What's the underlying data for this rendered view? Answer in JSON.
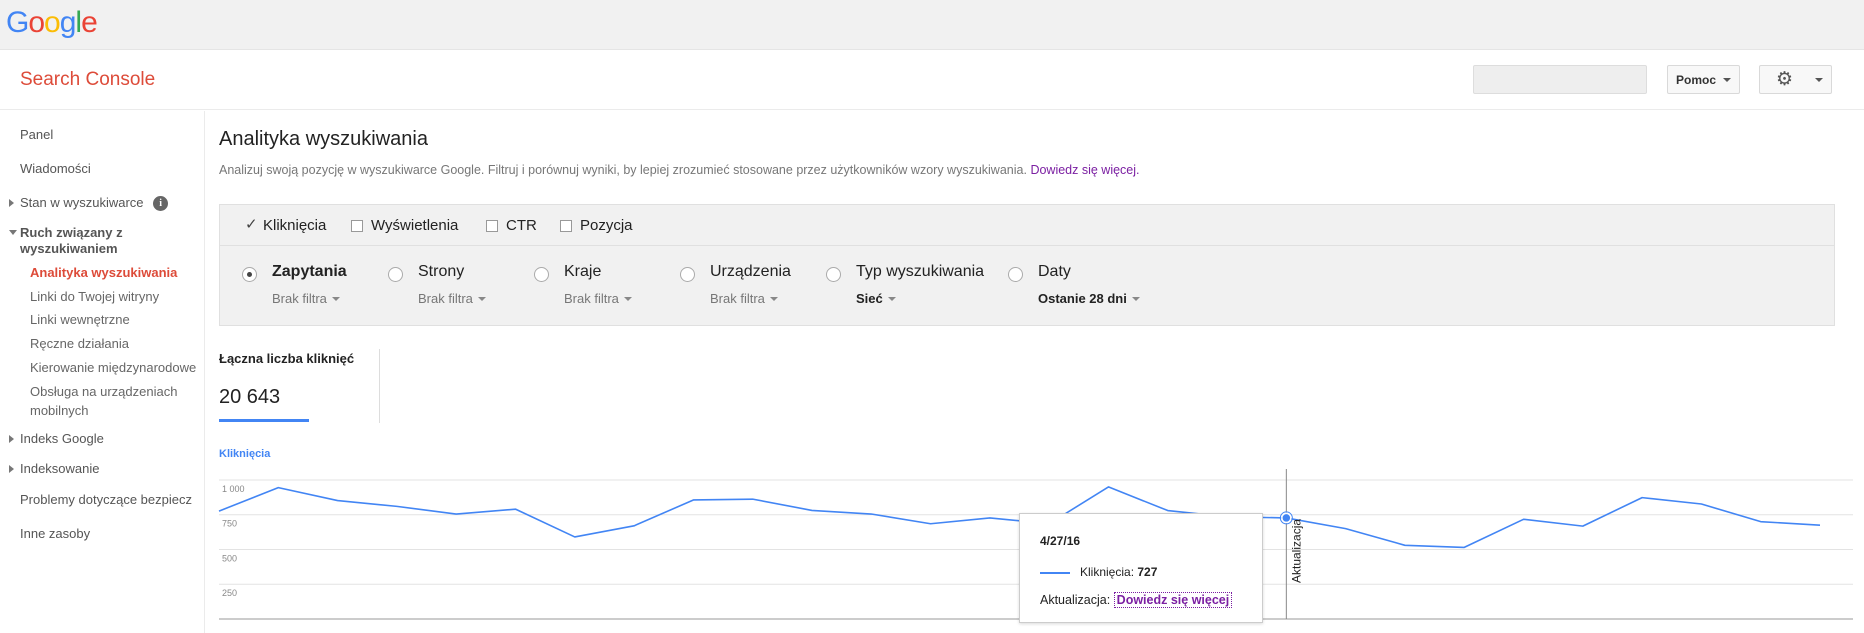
{
  "google_logo": [
    "G",
    "o",
    "o",
    "g",
    "l",
    "e"
  ],
  "colors": {
    "logo": [
      "#4285f4",
      "#ea4335",
      "#fbbc05",
      "#4285f4",
      "#34a853",
      "#ea4335"
    ],
    "accent_red": "#dd4b39",
    "series_blue": "#4285f4",
    "link_purple": "#7b1fa2"
  },
  "header": {
    "title": "Search Console",
    "help_label": "Pomoc",
    "settings_icon": "gear-icon"
  },
  "sidebar": {
    "panel": "Panel",
    "messages": "Wiadomości",
    "search_appearance": "Stan w wyszukiwarce",
    "search_traffic_group": "Ruch związany z",
    "search_traffic_group_2": "wyszukiwaniem",
    "sub": {
      "analytics": "Analityka wyszukiwania",
      "links_to_site": "Linki do Twojej witryny",
      "internal_links": "Linki wewnętrzne",
      "manual_actions": "Ręczne działania",
      "international": "Kierowanie międzynarodowe",
      "mobile_1": "Obsługa na urządzeniach",
      "mobile_2": "mobilnych"
    },
    "google_index": "Indeks Google",
    "crawl": "Indeksowanie",
    "security": "Problemy dotyczące bezpiecz",
    "other": "Inne zasoby"
  },
  "main": {
    "title": "Analityka wyszukiwania",
    "description": "Analizuj swoją pozycję w wyszukiwarce Google. Filtruj i porównuj wyniki, by lepiej zrozumieć stosowane przez użytkowników wzory wyszukiwania.",
    "learn_more": "Dowiedz się więcej."
  },
  "metrics": [
    {
      "label": "Kliknięcia",
      "checked": true
    },
    {
      "label": "Wyświetlenia",
      "checked": false
    },
    {
      "label": "CTR",
      "checked": false
    },
    {
      "label": "Pozycja",
      "checked": false
    }
  ],
  "dimensions": [
    {
      "label": "Zapytania",
      "filter": "Brak filtra",
      "selected": true
    },
    {
      "label": "Strony",
      "filter": "Brak filtra",
      "selected": false
    },
    {
      "label": "Kraje",
      "filter": "Brak filtra",
      "selected": false
    },
    {
      "label": "Urządzenia",
      "filter": "Brak filtra",
      "selected": false
    },
    {
      "label": "Typ wyszukiwania",
      "filter": "Sieć",
      "selected": false
    },
    {
      "label": "Daty",
      "filter": "Ostanie 28 dni",
      "selected": false
    }
  ],
  "summary": {
    "label": "Łączna liczba kliknięć",
    "value": "20 643"
  },
  "chart_data": {
    "type": "line",
    "series": [
      {
        "name": "Kliknięcia",
        "values": [
          776,
          945,
          852,
          810,
          755,
          790,
          590,
          670,
          856,
          862,
          781,
          755,
          685,
          727,
          685,
          950,
          780,
          735,
          727,
          650,
          530,
          515,
          717,
          668,
          873,
          827,
          700,
          675
        ]
      }
    ],
    "yticks": [
      "1 000",
      "750",
      "500",
      "250"
    ],
    "ytick_values": [
      1000,
      750,
      500,
      250
    ],
    "ylim": [
      0,
      1050
    ],
    "grid": true,
    "annotation": {
      "index": 18,
      "label": "Aktualizacja"
    }
  },
  "tooltip": {
    "date": "4/27/16",
    "series_label": "Kliknięcia:",
    "series_value": "727",
    "annotation_label": "Aktualizacja:",
    "annotation_link": "Dowiedz się więcej"
  }
}
